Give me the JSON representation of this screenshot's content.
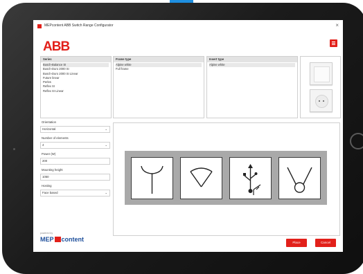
{
  "window": {
    "title": "MEPcontent ABB Switch Range Configurator",
    "close_glyph": "×"
  },
  "brand": {
    "logo": "ABB",
    "accent_color": "#e2201a",
    "menu_icon": "hamburger-menu-icon"
  },
  "series_panel": {
    "header": "Series",
    "items": [
      "Busch-Balance SI",
      "Busch-Duro 2000 SI",
      "Busch-Duro 2000 SI Linear",
      "Future linear",
      "Perles",
      "Reflex SI",
      "Reflex SI Linear"
    ],
    "selected": "Busch-Balance SI"
  },
  "frame_panel": {
    "header": "Frame type",
    "items": [
      "Alpine white",
      "Full frame"
    ],
    "selected": "Alpine white"
  },
  "insert_panel": {
    "header": "Insert type",
    "items": [
      "Alpine white"
    ],
    "selected": "Alpine white"
  },
  "options": {
    "orientation_label": "Orientation",
    "orientation_value": "Horizontal",
    "elements_label": "Number of elements",
    "elements_value": "4",
    "power_label": "Power (W)",
    "power_value": "200",
    "mounting_label": "Mounting height",
    "mounting_value": "1050",
    "hosting_label": "Hosting",
    "hosting_value": "Face based",
    "dropdown_glyph": "⌄"
  },
  "stage": {
    "symbols": [
      "antenna-socket-symbol",
      "light-dimmer-symbol",
      "usb-symbol",
      "switch-symbol"
    ]
  },
  "footer": {
    "powered_by": "powered by",
    "mep_brand": "MEP",
    "mep_content": "content",
    "place_label": "Place",
    "cancel_label": "Cancel"
  }
}
